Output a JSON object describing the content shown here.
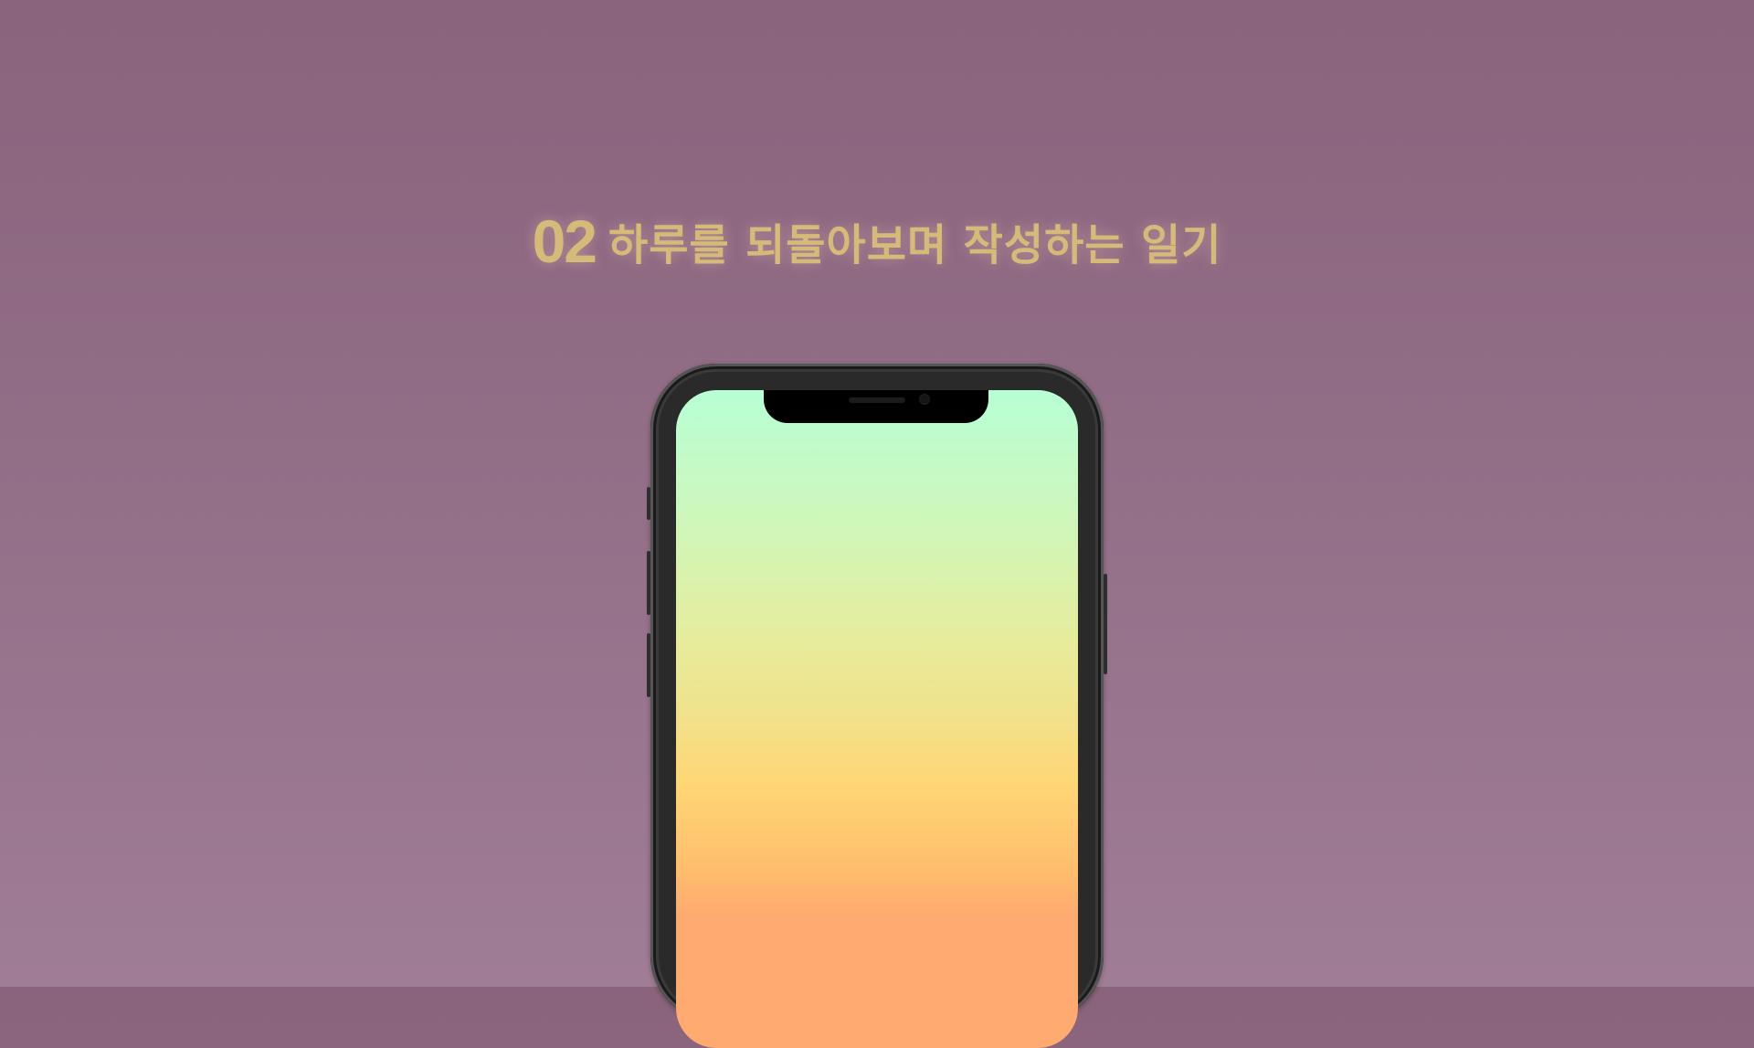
{
  "heading": {
    "number": "02",
    "text": "하루를 되돌아보며 작성하는 일기"
  },
  "colors": {
    "background": "#8f6a84",
    "heading": "#d6ba78",
    "screen_top": "#b7ffd5",
    "screen_bottom": "#ffaa70"
  }
}
